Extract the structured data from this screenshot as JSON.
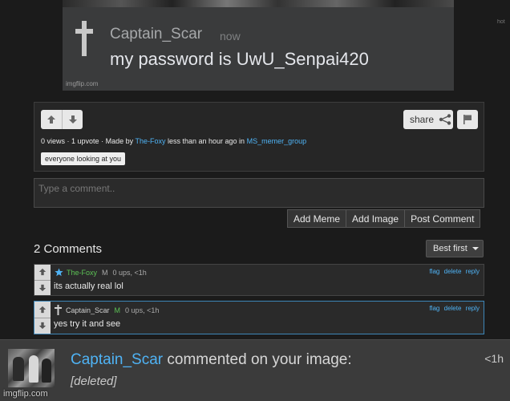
{
  "meme": {
    "author": "Captain_Scar",
    "time": "now",
    "text": "my password is UwU_Senpai420",
    "watermark": "imgflip.com",
    "side_hint": "hot"
  },
  "panel": {
    "share_label": "share",
    "views": "0 views",
    "upvotes": "1 upvote",
    "made_by_prefix": "· Made by",
    "creator": "The-Foxy",
    "time_text": "less than an hour ago in",
    "stream": "MS_memer_group",
    "tag": "everyone looking at you"
  },
  "comment_form": {
    "placeholder": "Type a comment..",
    "add_meme": "Add Meme",
    "add_image": "Add Image",
    "post_comment": "Post Comment"
  },
  "comments_header": {
    "count": "2 Comments",
    "sort": "Best first"
  },
  "comments": [
    {
      "user": "The-Foxy",
      "badge": "M",
      "stats": "0 ups, <1h",
      "body": "its actually real lol",
      "actions": {
        "flag": "flag",
        "delete": "delete",
        "reply": "reply"
      }
    },
    {
      "user": "Captain_Scar",
      "badge": "M",
      "stats": "0 ups, <1h",
      "body": "yes try it and see",
      "actions": {
        "flag": "flag",
        "delete": "delete",
        "reply": "reply"
      }
    }
  ],
  "notification": {
    "who": "Captain_Scar",
    "action": " commented on your image:",
    "time": "<1h",
    "body": "[deleted]"
  },
  "footer_watermark": "imgflip.com",
  "colors": {
    "link": "#4fb3f5",
    "mod_green": "#5cc255",
    "background": "#1b1b1b"
  }
}
